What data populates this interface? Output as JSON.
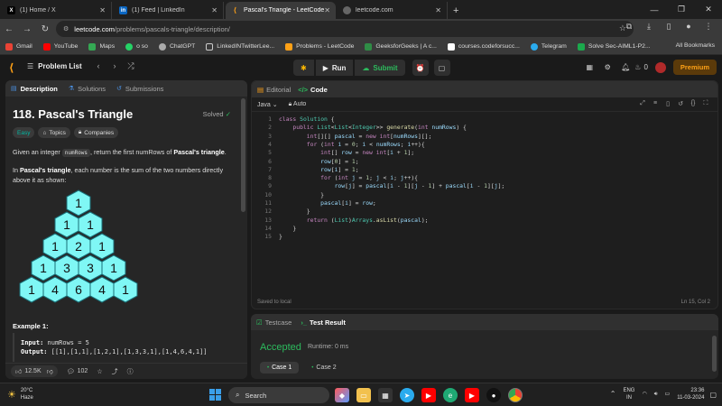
{
  "browser": {
    "tabs": [
      {
        "title": "(1) Home / X",
        "icon": "x-logo-icon",
        "color": "#000000"
      },
      {
        "title": "(1) Feed | LinkedIn",
        "icon": "linkedin-icon",
        "color": "#0a66c2"
      },
      {
        "title": "Pascal's Triangle - LeetCode",
        "icon": "leetcode-icon",
        "color": "#ffa116"
      },
      {
        "title": "leetcode.com",
        "icon": "globe-icon",
        "color": "#888888"
      }
    ],
    "url_host": "leetcode.com",
    "url_path": "/problems/pascals-triangle/description/",
    "bookmarks": [
      {
        "label": "Gmail",
        "color": "#ea4335"
      },
      {
        "label": "YouTube",
        "color": "#ff0000"
      },
      {
        "label": "Maps",
        "color": "#34a853"
      },
      {
        "label": "o so",
        "color": "#25d366"
      },
      {
        "label": "ChatGPT",
        "color": "#aaaaaa"
      },
      {
        "label": "LinkedINTwitterLee...",
        "color": "#cccccc"
      },
      {
        "label": "Problems - LeetCode",
        "color": "#ffa116"
      },
      {
        "label": "GeeksforGeeks | A c...",
        "color": "#2f8d46"
      },
      {
        "label": "courses.codeforsucc...",
        "color": "#ffffff"
      },
      {
        "label": "Telegram",
        "color": "#2aabee"
      },
      {
        "label": "Solve Sec-AIML1-P2...",
        "color": "#1ba94c"
      }
    ],
    "all_bookmarks": "All Bookmarks"
  },
  "lc": {
    "problem_list": "Problem List",
    "run": "Run",
    "submit": "Submit",
    "coins": "0",
    "premium": "Premium"
  },
  "left": {
    "tabs": [
      "Description",
      "Solutions",
      "Submissions"
    ],
    "title": "118. Pascal's Triangle",
    "solved": "Solved",
    "chips": [
      "Easy",
      "Topics",
      "Companies"
    ],
    "desc_pre": "Given an integer ",
    "desc_code": "numRows",
    "desc_mid": ", return the first numRows of ",
    "desc_bold": "Pascal's triangle",
    "desc_end": ".",
    "desc2_pre": "In ",
    "desc2_bold": "Pascal's triangle",
    "desc2_end": ", each number is the sum of the two numbers directly above it as shown:",
    "triangle": [
      [
        1
      ],
      [
        1,
        1
      ],
      [
        1,
        2,
        1
      ],
      [
        1,
        3,
        3,
        1
      ],
      [
        1,
        4,
        6,
        4,
        1
      ]
    ],
    "example_title": "Example 1:",
    "input_label": "Input:",
    "input_value": "numRows = 5",
    "output_label": "Output:",
    "output_value": "[[1],[1,1],[1,2,1],[1,3,3,1],[1,4,6,4,1]]",
    "likes": "12.5K",
    "comments": "102"
  },
  "editor": {
    "tabs": [
      "Editorial",
      "Code"
    ],
    "language": "Java",
    "mode": "Auto",
    "lines": [
      "class Solution {",
      "    public List<List<Integer>> generate(int numRows) {",
      "        int[][] pascal = new int[numRows][];",
      "        for (int i = 0; i < numRows; i++){",
      "            int[] row = new int[i + 1];",
      "            row[0] = 1;",
      "            row[i] = 1;",
      "            for (int j = 1; j < i; j++){",
      "                row[j] = pascal[i - 1][j - 1] + pascal[i - 1][j];",
      "            }",
      "            pascal[i] = row;",
      "        }",
      "        return (List)Arrays.asList(pascal);",
      "    }",
      "}"
    ],
    "saved": "Saved to local",
    "position": "Ln 15, Col 2"
  },
  "result": {
    "tabs": [
      "Testcase",
      "Test Result"
    ],
    "status": "Accepted",
    "runtime": "Runtime: 0 ms",
    "cases": [
      "Case 1",
      "Case 2"
    ]
  },
  "taskbar": {
    "temp": "20°C",
    "weather": "Haze",
    "search": "Search",
    "lang1": "ENG",
    "lang2": "IN",
    "time": "23:36",
    "date": "11-03-2024"
  }
}
